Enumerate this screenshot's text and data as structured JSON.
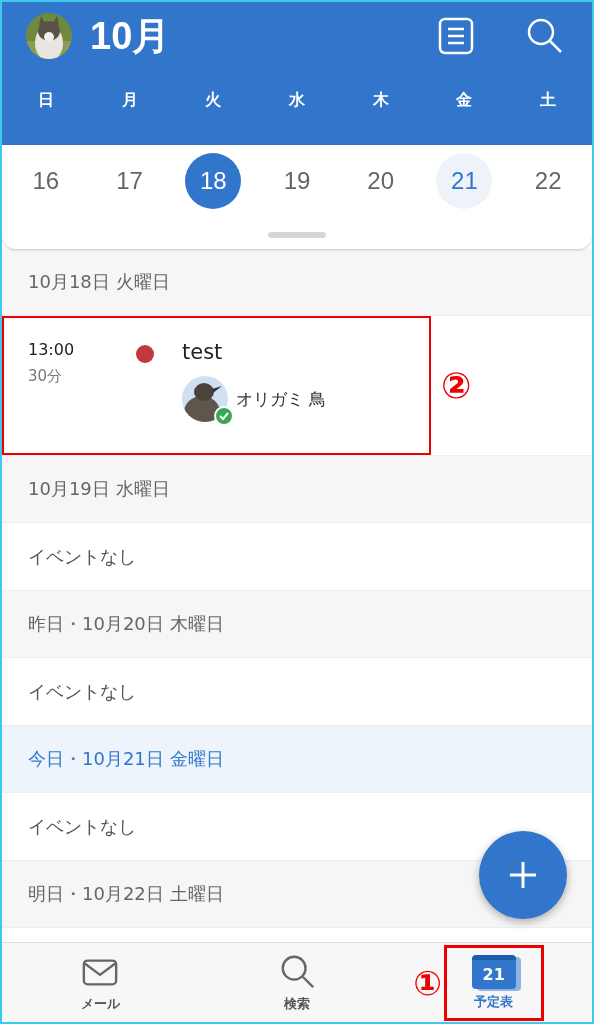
{
  "header": {
    "title": "10月"
  },
  "weekdays": [
    "日",
    "月",
    "火",
    "水",
    "木",
    "金",
    "土"
  ],
  "dates": [
    {
      "day": "16",
      "selected": false,
      "today": false
    },
    {
      "day": "17",
      "selected": false,
      "today": false
    },
    {
      "day": "18",
      "selected": true,
      "today": false
    },
    {
      "day": "19",
      "selected": false,
      "today": false
    },
    {
      "day": "20",
      "selected": false,
      "today": false
    },
    {
      "day": "21",
      "selected": false,
      "today": true
    },
    {
      "day": "22",
      "selected": false,
      "today": false
    }
  ],
  "agenda": [
    {
      "kind": "header",
      "label": "10月18日 火曜日",
      "today": false
    },
    {
      "kind": "event",
      "time": "13:00",
      "duration": "30分",
      "title": "test",
      "color": "#c0393b",
      "attendee": "オリガミ 鳥",
      "accepted": true,
      "annotation": "②"
    },
    {
      "kind": "header",
      "label": "10月19日 水曜日",
      "today": false
    },
    {
      "kind": "empty",
      "label": "イベントなし"
    },
    {
      "kind": "header",
      "label": "昨日・10月20日 木曜日",
      "today": false
    },
    {
      "kind": "empty",
      "label": "イベントなし"
    },
    {
      "kind": "header",
      "label": "今日・10月21日 金曜日",
      "today": true
    },
    {
      "kind": "empty",
      "label": "イベントなし"
    },
    {
      "kind": "header",
      "label": "明日・10月22日 土曜日",
      "today": false
    }
  ],
  "tabs": [
    {
      "kind": "mail",
      "label": "メール",
      "selected": false
    },
    {
      "kind": "search",
      "label": "検索",
      "selected": false
    },
    {
      "kind": "calendar",
      "label": "予定表",
      "selected": true,
      "icon_text": "21",
      "annotation": "①"
    }
  ]
}
